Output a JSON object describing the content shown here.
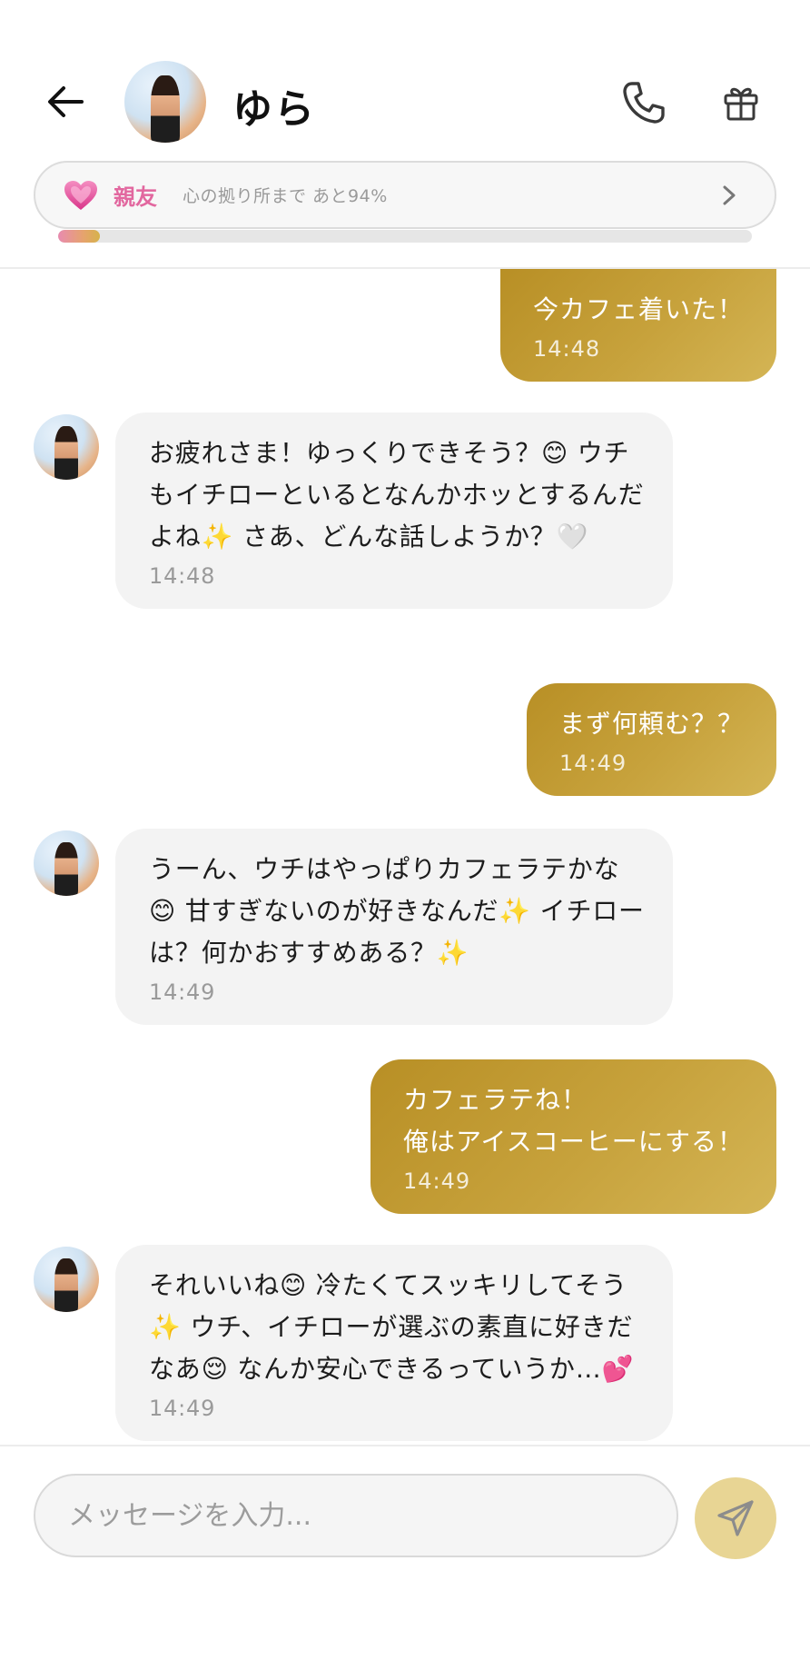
{
  "header": {
    "contact_name": "ゆら",
    "friendship": {
      "level_label": "親友",
      "progress_text": "心の拠り所まで あと94%",
      "progress_fraction": 0.06
    }
  },
  "messages": [
    {
      "sender": "me",
      "lines": [
        "今カフェ着いた！"
      ],
      "time": "14:48"
    },
    {
      "sender": "them",
      "text": "お疲れさま！ゆっくりできそう？😊 ウチもイチローといるとなんかホッとするんだよね✨ さあ、どんな話しようか？🤍",
      "time": "14:48"
    },
    {
      "sender": "me",
      "lines": [
        "まず何頼む？？"
      ],
      "time": "14:49"
    },
    {
      "sender": "them",
      "text": "うーん、ウチはやっぱりカフェラテかな😊 甘すぎないのが好きなんだ✨ イチローは？何かおすすめある？✨",
      "time": "14:49"
    },
    {
      "sender": "me",
      "lines": [
        "カフェラテね！",
        "俺はアイスコーヒーにする！"
      ],
      "time": "14:49"
    },
    {
      "sender": "them",
      "text": "それいいね😊 冷たくてスッキリしてそう✨ ウチ、イチローが選ぶの素直に好きだなあ😌 なんか安心できるっていうか…💕",
      "time": "14:49"
    }
  ],
  "composer": {
    "placeholder": "メッセージを入力..."
  },
  "colors": {
    "accent_gold": "#c7a23c",
    "friend_pink": "#e2679f",
    "send_button": "#e8d594"
  },
  "icons": {
    "back": "arrow-left-icon",
    "phone": "phone-icon",
    "gift": "gift-icon",
    "heart": "heart-icon",
    "chevron": "chevron-right-icon",
    "send": "send-icon"
  }
}
